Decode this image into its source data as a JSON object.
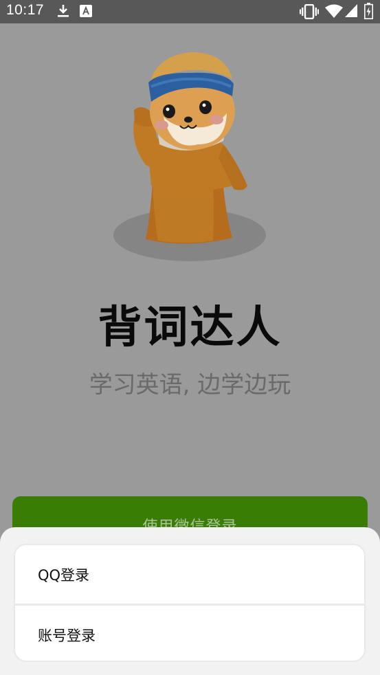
{
  "status_bar": {
    "time": "10:17",
    "icons": [
      "download-icon",
      "font-a-icon",
      "vibrate-icon",
      "wifi-icon",
      "signal-icon",
      "battery-charging-icon"
    ]
  },
  "app": {
    "title": "背词达人",
    "subtitle": "学习英语, 边学边玩"
  },
  "wechat_login": {
    "label": "使用微信登录"
  },
  "login_sheet": {
    "options": [
      {
        "label": "QQ登录"
      },
      {
        "label": "账号登录"
      }
    ]
  },
  "colors": {
    "overlay_background": "#9a9a9a",
    "status_bar": "#585858",
    "wechat_green": "#3a7d05",
    "sheet_background": "#f2f2f2"
  }
}
